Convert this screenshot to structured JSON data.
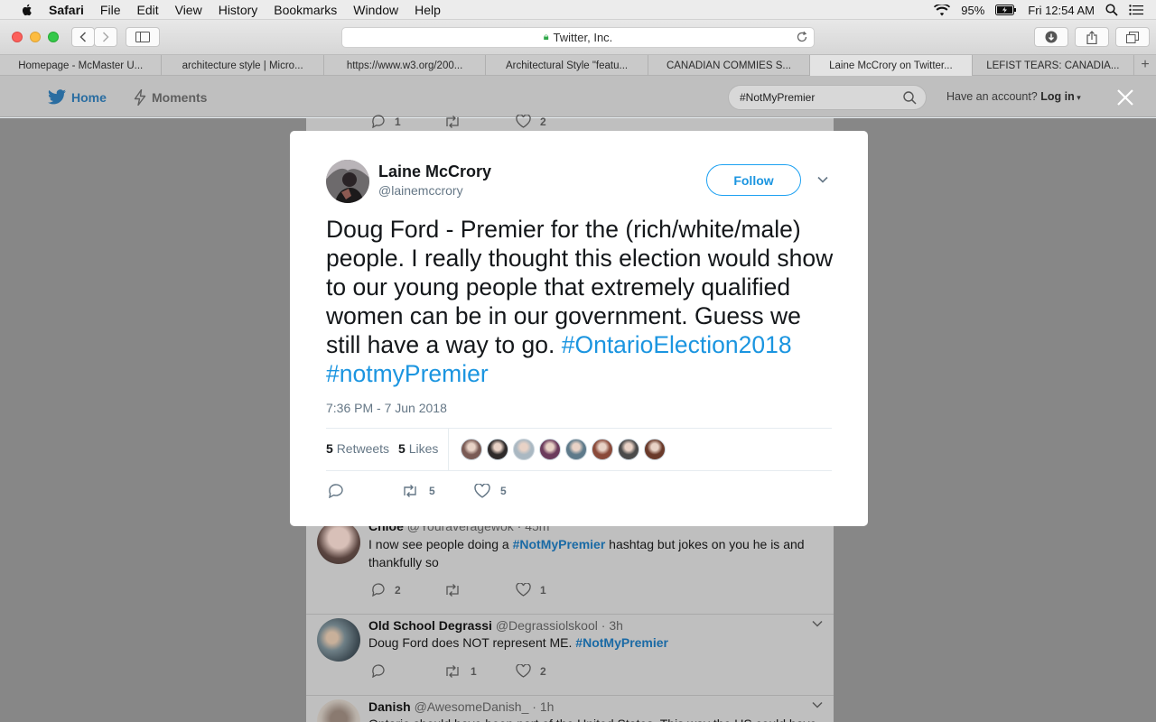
{
  "menubar": {
    "app": "Safari",
    "items": [
      "File",
      "Edit",
      "View",
      "History",
      "Bookmarks",
      "Window",
      "Help"
    ],
    "battery": "95%",
    "clock": "Fri 12:54 AM"
  },
  "browser": {
    "address": "Twitter, Inc.",
    "tabs": [
      "Homepage - McMaster U...",
      "architecture style | Micro...",
      "https://www.w3.org/200...",
      "Architectural Style \"featu...",
      "CANADIAN COMMIES S...",
      "Laine McCrory on Twitter...",
      "LEFIST TEARS: CANADIA..."
    ],
    "active_tab": 5
  },
  "twitter_header": {
    "home": "Home",
    "moments": "Moments",
    "search_value": "#NotMyPremier",
    "account_prompt": "Have an account?",
    "login": "Log in"
  },
  "modal_tweet": {
    "name": "Laine McCrory",
    "handle": "@lainemccrory",
    "follow_label": "Follow",
    "text": "Doug Ford - Premier for the (rich/white/male) people. I really thought this election would show to our young people that extremely qualified women can be in our government. Guess we still have a way to go.",
    "hashtag1": "#OntarioElection2018",
    "hashtag2": "#notmyPremier",
    "timestamp": "7:36 PM - 7 Jun 2018",
    "retweets_count": "5",
    "retweets_label": "Retweets",
    "likes_count": "5",
    "likes_label": "Likes",
    "action_retweets": "5",
    "action_likes": "5",
    "liker_colors": [
      "#7a5b55",
      "#2e2a2a",
      "#aab8c2",
      "#6b3b5c",
      "#5e7a8a",
      "#8a4a3a",
      "#4a4a4a",
      "#6a3a2a"
    ]
  },
  "timeline": {
    "partial_top": {
      "replies": "1",
      "retweets": "",
      "likes": "2"
    },
    "tweets": [
      {
        "name": "Chloe",
        "handle": "@Youraveragewok",
        "age": "45m",
        "text_before": "I now see people doing a ",
        "hashtag": "#NotMyPremier",
        "text_after": " hashtag but jokes on you he is and thankfully so",
        "replies": "2",
        "retweets": "",
        "likes": "1"
      },
      {
        "name": "Old School Degrassi",
        "handle": "@Degrassiolskool",
        "age": "3h",
        "text_before": "Doug Ford does NOT represent ME. ",
        "hashtag": "#NotMyPremier",
        "text_after": "",
        "replies": "",
        "retweets": "1",
        "likes": "2"
      },
      {
        "name": "Danish",
        "handle": "@AwesomeDanish_",
        "age": "1h",
        "text_before": "Ontario should have been part of the United States. This way the US could have",
        "hashtag": "",
        "text_after": "",
        "replies": "",
        "retweets": "",
        "likes": ""
      }
    ]
  }
}
